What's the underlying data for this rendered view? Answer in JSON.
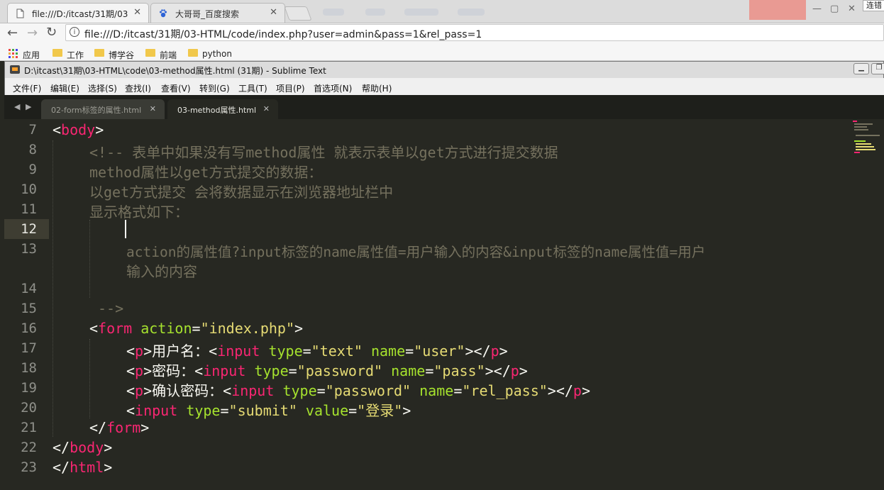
{
  "browser": {
    "tabs": [
      {
        "title": "file:///D:/itcast/31期/03",
        "active": true
      },
      {
        "title": "大哥哥_百度搜索",
        "active": false
      }
    ],
    "corner_label": "连错",
    "url": "file:///D:/itcast/31期/03-HTML/code/index.php?user=admin&pass=1&rel_pass=1",
    "bookmarks": [
      "应用",
      "工作",
      "博学谷",
      "前端",
      "python"
    ]
  },
  "sublime": {
    "window_title": "D:\\itcast\\31期\\03-HTML\\code\\03-method属性.html (31期) - Sublime Text",
    "menu": [
      "文件(F)",
      "编辑(E)",
      "选择(S)",
      "查找(I)",
      "查看(V)",
      "转到(G)",
      "工具(T)",
      "项目(P)",
      "首选项(N)",
      "帮助(H)"
    ],
    "tabs": [
      {
        "label": "02-form标签的属性.html",
        "active": false
      },
      {
        "label": "03-method属性.html",
        "active": true
      }
    ],
    "line_numbers": [
      "7",
      "8",
      "9",
      "10",
      "11",
      "12",
      "13",
      "14",
      "15",
      "16",
      "17",
      "18",
      "19",
      "20",
      "21",
      "22",
      "23"
    ],
    "colors": {
      "background": "#272822",
      "tag": "#f92672",
      "attribute": "#a6e22e",
      "string": "#e6db74",
      "comment": "#75715e",
      "text": "#f8f8f2"
    }
  },
  "code": {
    "l7": {
      "lt": "<",
      "tag": "body",
      "gt": ">"
    },
    "l8": "<!-- 表单中如果没有写method属性 就表示表单以get方式进行提交数据",
    "l9": "method属性以get方式提交的数据：",
    "l10": "以get方式提交 会将数据显示在浏览器地址栏中",
    "l11": "显示格式如下：",
    "l13a": "action的属性值?input标签的name属性值=用户输入的内容&input标签的name属性值=用户",
    "l13b": "输入的内容",
    "l15": "-->",
    "l16": {
      "lt": "<",
      "tag": "form",
      "attr": "action",
      "eq": "=",
      "val": "\"index.php\"",
      "gt": ">"
    },
    "l17": {
      "p_open": "p",
      "label": "用户名：",
      "input": "input",
      "a1": "type",
      "v1": "\"text\"",
      "a2": "name",
      "v2": "\"user\"",
      "p_close": "p"
    },
    "l18": {
      "p_open": "p",
      "label": "密码：",
      "input": "input",
      "a1": "type",
      "v1": "\"password\"",
      "a2": "name",
      "v2": "\"pass\"",
      "p_close": "p"
    },
    "l19": {
      "p_open": "p",
      "label": "确认密码：",
      "input": "input",
      "a1": "type",
      "v1": "\"password\"",
      "a2": "name",
      "v2": "\"rel_pass\"",
      "p_close": "p"
    },
    "l20": {
      "input": "input",
      "a1": "type",
      "v1": "\"submit\"",
      "a2": "value",
      "v2": "\"登录\""
    },
    "l21": {
      "tag": "form"
    },
    "l22": {
      "tag": "body"
    },
    "l23": {
      "tag": "html"
    }
  }
}
